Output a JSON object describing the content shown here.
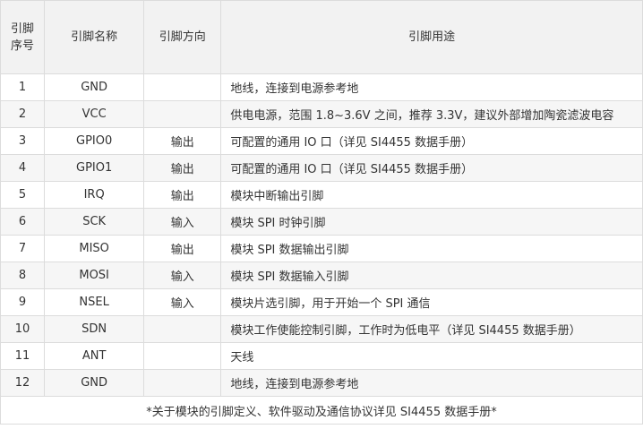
{
  "header": {
    "pin_no_line1": "引脚",
    "pin_no_line2": "序号",
    "pin_name": "引脚名称",
    "pin_dir": "引脚方向",
    "pin_use": "引脚用途"
  },
  "rows": [
    {
      "no": "1",
      "name": "GND",
      "dir": "",
      "use": "地线，连接到电源参考地"
    },
    {
      "no": "2",
      "name": "VCC",
      "dir": "",
      "use": "供电电源，范围 1.8~3.6V 之间，推荐 3.3V，建议外部增加陶瓷滤波电容"
    },
    {
      "no": "3",
      "name": "GPIO0",
      "dir": "输出",
      "use": "可配置的通用 IO 口（详见 SI4455 数据手册）"
    },
    {
      "no": "4",
      "name": "GPIO1",
      "dir": "输出",
      "use": "可配置的通用 IO 口（详见 SI4455 数据手册）"
    },
    {
      "no": "5",
      "name": "IRQ",
      "dir": "输出",
      "use": "模块中断输出引脚"
    },
    {
      "no": "6",
      "name": "SCK",
      "dir": "输入",
      "use": "模块 SPI 时钟引脚"
    },
    {
      "no": "7",
      "name": "MISO",
      "dir": "输出",
      "use": "模块 SPI 数据输出引脚"
    },
    {
      "no": "8",
      "name": "MOSI",
      "dir": "输入",
      "use": "模块 SPI 数据输入引脚"
    },
    {
      "no": "9",
      "name": "NSEL",
      "dir": "输入",
      "use": "模块片选引脚，用于开始一个 SPI 通信"
    },
    {
      "no": "10",
      "name": "SDN",
      "dir": "",
      "use": "模块工作使能控制引脚，工作时为低电平（详见 SI4455 数据手册）"
    },
    {
      "no": "11",
      "name": "ANT",
      "dir": "",
      "use": "天线"
    },
    {
      "no": "12",
      "name": "GND",
      "dir": "",
      "use": "地线，连接到电源参考地"
    }
  ],
  "footnote": "*关于模块的引脚定义、软件驱动及通信协议详见 SI4455 数据手册*"
}
